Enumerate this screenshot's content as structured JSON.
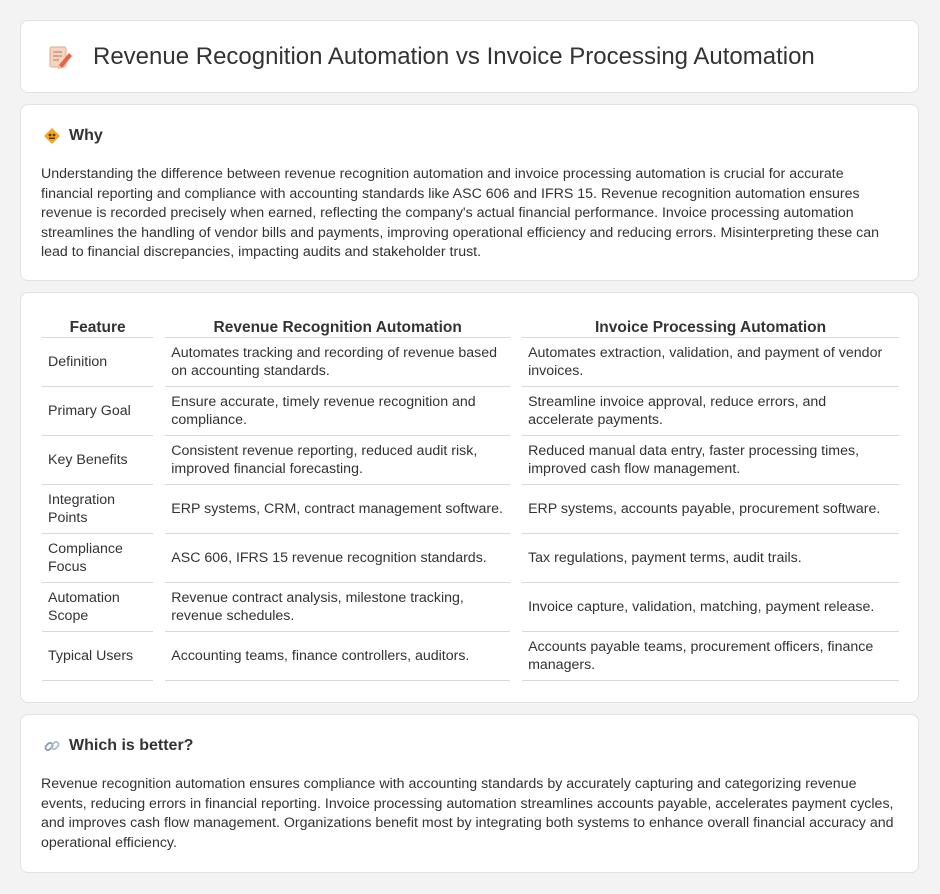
{
  "header": {
    "title": "Revenue Recognition Automation vs Invoice Processing Automation",
    "icon": "memo-pencil-icon"
  },
  "why": {
    "icon": "diamond-sign-icon",
    "title": "Why",
    "text": "Understanding the difference between revenue recognition automation and invoice processing automation is crucial for accurate financial reporting and compliance with accounting standards like ASC 606 and IFRS 15. Revenue recognition automation ensures revenue is recorded precisely when earned, reflecting the company's actual financial performance. Invoice processing automation streamlines the handling of vendor bills and payments, improving operational efficiency and reducing errors. Misinterpreting these can lead to financial discrepancies, impacting audits and stakeholder trust."
  },
  "table": {
    "headers": [
      "Feature",
      "Revenue Recognition Automation",
      "Invoice Processing Automation"
    ],
    "rows": [
      {
        "feature": "Definition",
        "revenue": "Automates tracking and recording of revenue based on accounting standards.",
        "invoice": "Automates extraction, validation, and payment of vendor invoices."
      },
      {
        "feature": "Primary Goal",
        "revenue": "Ensure accurate, timely revenue recognition and compliance.",
        "invoice": "Streamline invoice approval, reduce errors, and accelerate payments."
      },
      {
        "feature": "Key Benefits",
        "revenue": "Consistent revenue reporting, reduced audit risk, improved financial forecasting.",
        "invoice": "Reduced manual data entry, faster processing times, improved cash flow management."
      },
      {
        "feature": "Integration Points",
        "revenue": "ERP systems, CRM, contract management software.",
        "invoice": "ERP systems, accounts payable, procurement software."
      },
      {
        "feature": "Compliance Focus",
        "revenue": "ASC 606, IFRS 15 revenue recognition standards.",
        "invoice": "Tax regulations, payment terms, audit trails."
      },
      {
        "feature": "Automation Scope",
        "revenue": "Revenue contract analysis, milestone tracking, revenue schedules.",
        "invoice": "Invoice capture, validation, matching, payment release."
      },
      {
        "feature": "Typical Users",
        "revenue": "Accounting teams, finance controllers, auditors.",
        "invoice": "Accounts payable teams, procurement officers, finance managers."
      }
    ]
  },
  "better": {
    "icon": "link-icon",
    "title": "Which is better?",
    "text": "Revenue recognition automation ensures compliance with accounting standards by accurately capturing and categorizing revenue events, reducing errors in financial reporting. Invoice processing automation streamlines accounts payable, accelerates payment cycles, and improves cash flow management. Organizations benefit most by integrating both systems to enhance overall financial accuracy and operational efficiency."
  }
}
